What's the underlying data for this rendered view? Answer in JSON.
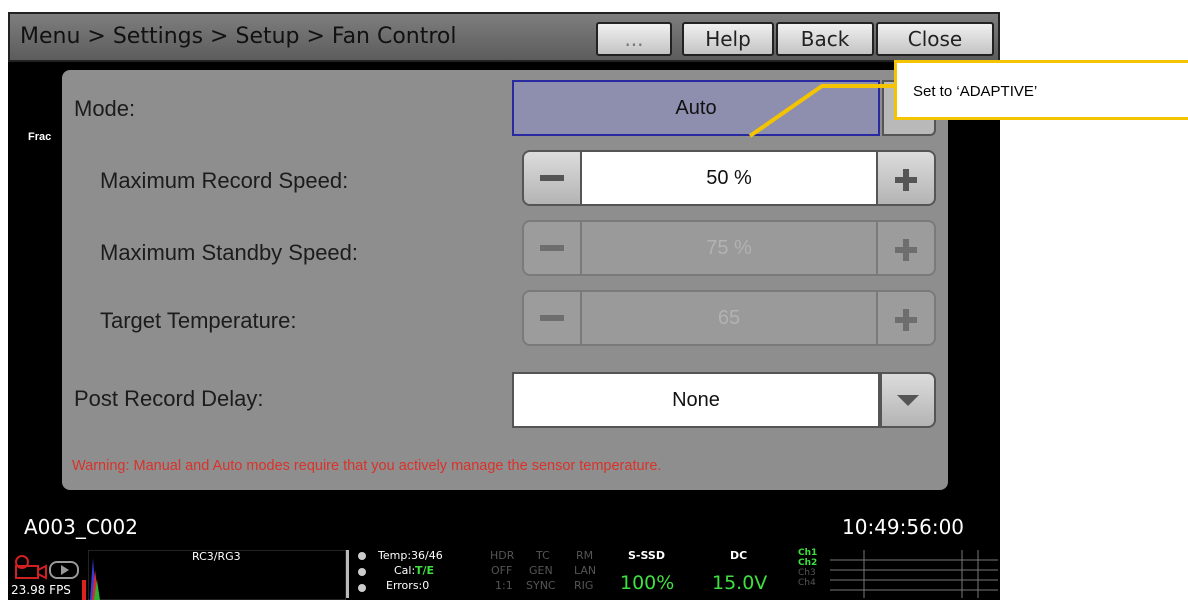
{
  "header": {
    "breadcrumb": "Menu > Settings > Setup > Fan Control",
    "buttons": {
      "more": "...",
      "help": "Help",
      "back": "Back",
      "close": "Close"
    }
  },
  "background_text": "Frac",
  "fan_control": {
    "mode": {
      "label": "Mode:",
      "value": "Auto"
    },
    "max_record_speed": {
      "label": "Maximum Record Speed:",
      "value": "50 %",
      "state": "enabled"
    },
    "max_standby_speed": {
      "label": "Maximum Standby Speed:",
      "value": "75 %",
      "state": "disabled"
    },
    "target_temperature": {
      "label": "Target Temperature:",
      "value": "65",
      "state": "disabled"
    },
    "post_record_delay": {
      "label": "Post Record Delay:",
      "value": "None"
    },
    "warning": "Warning: Manual and Auto modes require that you actively manage the sensor temperature."
  },
  "clip": {
    "name": "A003_C002",
    "timecode": "10:49:56:00"
  },
  "status_bar": {
    "fps": "23.98 FPS",
    "color_space": "RC3/RG3",
    "temp": "Temp:36/46",
    "cal_label": "Cal:",
    "cal_value": "T/E",
    "errors": "Errors:0",
    "hdr": [
      "HDR",
      "OFF",
      "1:1"
    ],
    "tc": [
      "TC",
      "GEN",
      "SYNC"
    ],
    "rm": [
      "RM",
      "LAN",
      "RIG"
    ],
    "media_label": "S-SSD",
    "media_value": "100%",
    "power_label": "DC",
    "power_value": "15.0V",
    "audio_channels": [
      "Ch1",
      "Ch2",
      "Ch3",
      "Ch4"
    ]
  },
  "annotation": {
    "text": "Set to ‘ADAPTIVE’"
  },
  "colors": {
    "accent": "#f5c400",
    "warning": "#d8332a",
    "mode_highlight": "#8e8faf",
    "status_green": "#3ee040"
  }
}
